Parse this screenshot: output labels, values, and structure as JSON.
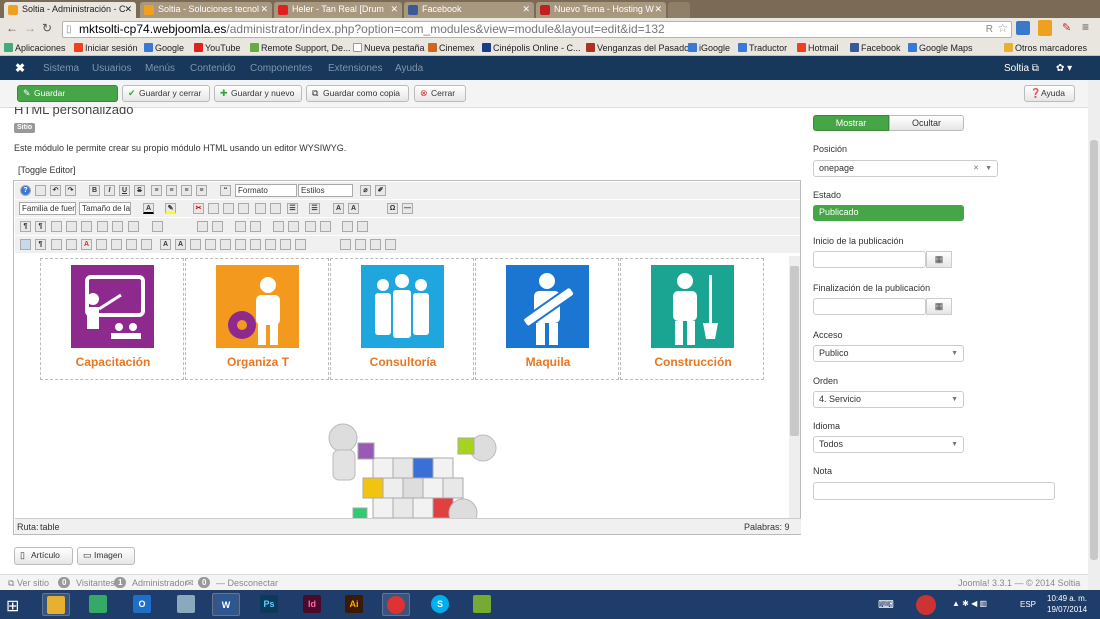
{
  "browser": {
    "tabs": [
      {
        "title": "Soltia - Administración - C",
        "color": "#f0a020"
      },
      {
        "title": "Soltia - Soluciones tecnol",
        "color": "#f0a020"
      },
      {
        "title": "Heler - Tan Real [Drum",
        "color": "#e02020"
      },
      {
        "title": "Facebook",
        "color": "#3b5998"
      },
      {
        "title": "Nuevo Tema - Hosting W",
        "color": "#c02020"
      }
    ],
    "url_domain": "mktsolti-cp74.webjoomla.es",
    "url_rest": "/administrator/index.php?option=com_modules&view=module&layout=edit&id=132",
    "bookmarks": [
      "Aplicaciones",
      "Iniciar sesión",
      "Google",
      "YouTube",
      "Remote Support, De...",
      "Nueva pestaña",
      "Cinemex",
      "Cinépolis Online - C...",
      "Venganzas del Pasado",
      "iGoogle",
      "Traductor",
      "Hotmail",
      "Facebook",
      "Google Maps"
    ],
    "other_bookmarks": "Otros marcadores"
  },
  "joomla_nav": {
    "items": [
      "Sistema",
      "Usuarios",
      "Menús",
      "Contenido",
      "Componentes",
      "Extensiones",
      "Ayuda"
    ],
    "user": "Soltia",
    "settings_icon": "gear-icon"
  },
  "toolbar": {
    "save": "Guardar",
    "save_close": "Guardar y cerrar",
    "save_new": "Guardar y nuevo",
    "save_copy": "Guardar como copia",
    "close": "Cerrar",
    "help": "Ayuda"
  },
  "module": {
    "title": "HTML personalizado",
    "badge": "Sitio",
    "description": "Este módulo le permite crear su propio módulo HTML usando un editor WYSIWYG.",
    "toggle_editor": "[Toggle Editor]"
  },
  "editor": {
    "format_select": "Formato",
    "styles_select": "Estilos",
    "font_family": "Familia de fuen",
    "font_size": "Tamaño de la f",
    "path_label": "Ruta:",
    "path_value": "table",
    "words_label": "Palabras: 9",
    "services": [
      {
        "label": "Capacitación",
        "color": "#8e2a8e"
      },
      {
        "label": "Organiza T",
        "color": "#f39a1e"
      },
      {
        "label": "Consultoría",
        "color": "#1fa6df"
      },
      {
        "label": "Maquila",
        "color": "#1b76d2"
      },
      {
        "label": "Construcción",
        "color": "#1aa593"
      }
    ]
  },
  "below_editor": {
    "article": "Artículo",
    "image": "Imagen"
  },
  "right_panel": {
    "show": "Mostrar",
    "hide": "Ocultar",
    "position_label": "Posición",
    "position_value": "onepage",
    "status_label": "Estado",
    "status_value": "Publicado",
    "start_label": "Inicio de la publicación",
    "finish_label": "Finalización de la publicación",
    "access_label": "Acceso",
    "access_value": "Publico",
    "order_label": "Orden",
    "order_value": "4. Servicio",
    "language_label": "Idioma",
    "language_value": "Todos",
    "note_label": "Nota",
    "note_value": ""
  },
  "footer": {
    "view_site": "Ver sitio",
    "visitors_count": "0",
    "visitors": "Visitantes",
    "admin_count": "1",
    "admin": "Administrador",
    "mail_count": "0",
    "logout": "Desconectar",
    "version": "Joomla! 3.3.1  —  © 2014 Soltia"
  },
  "taskbar": {
    "lang": "ESP",
    "time": "10:49 a. m.",
    "date": "19/07/2014"
  }
}
